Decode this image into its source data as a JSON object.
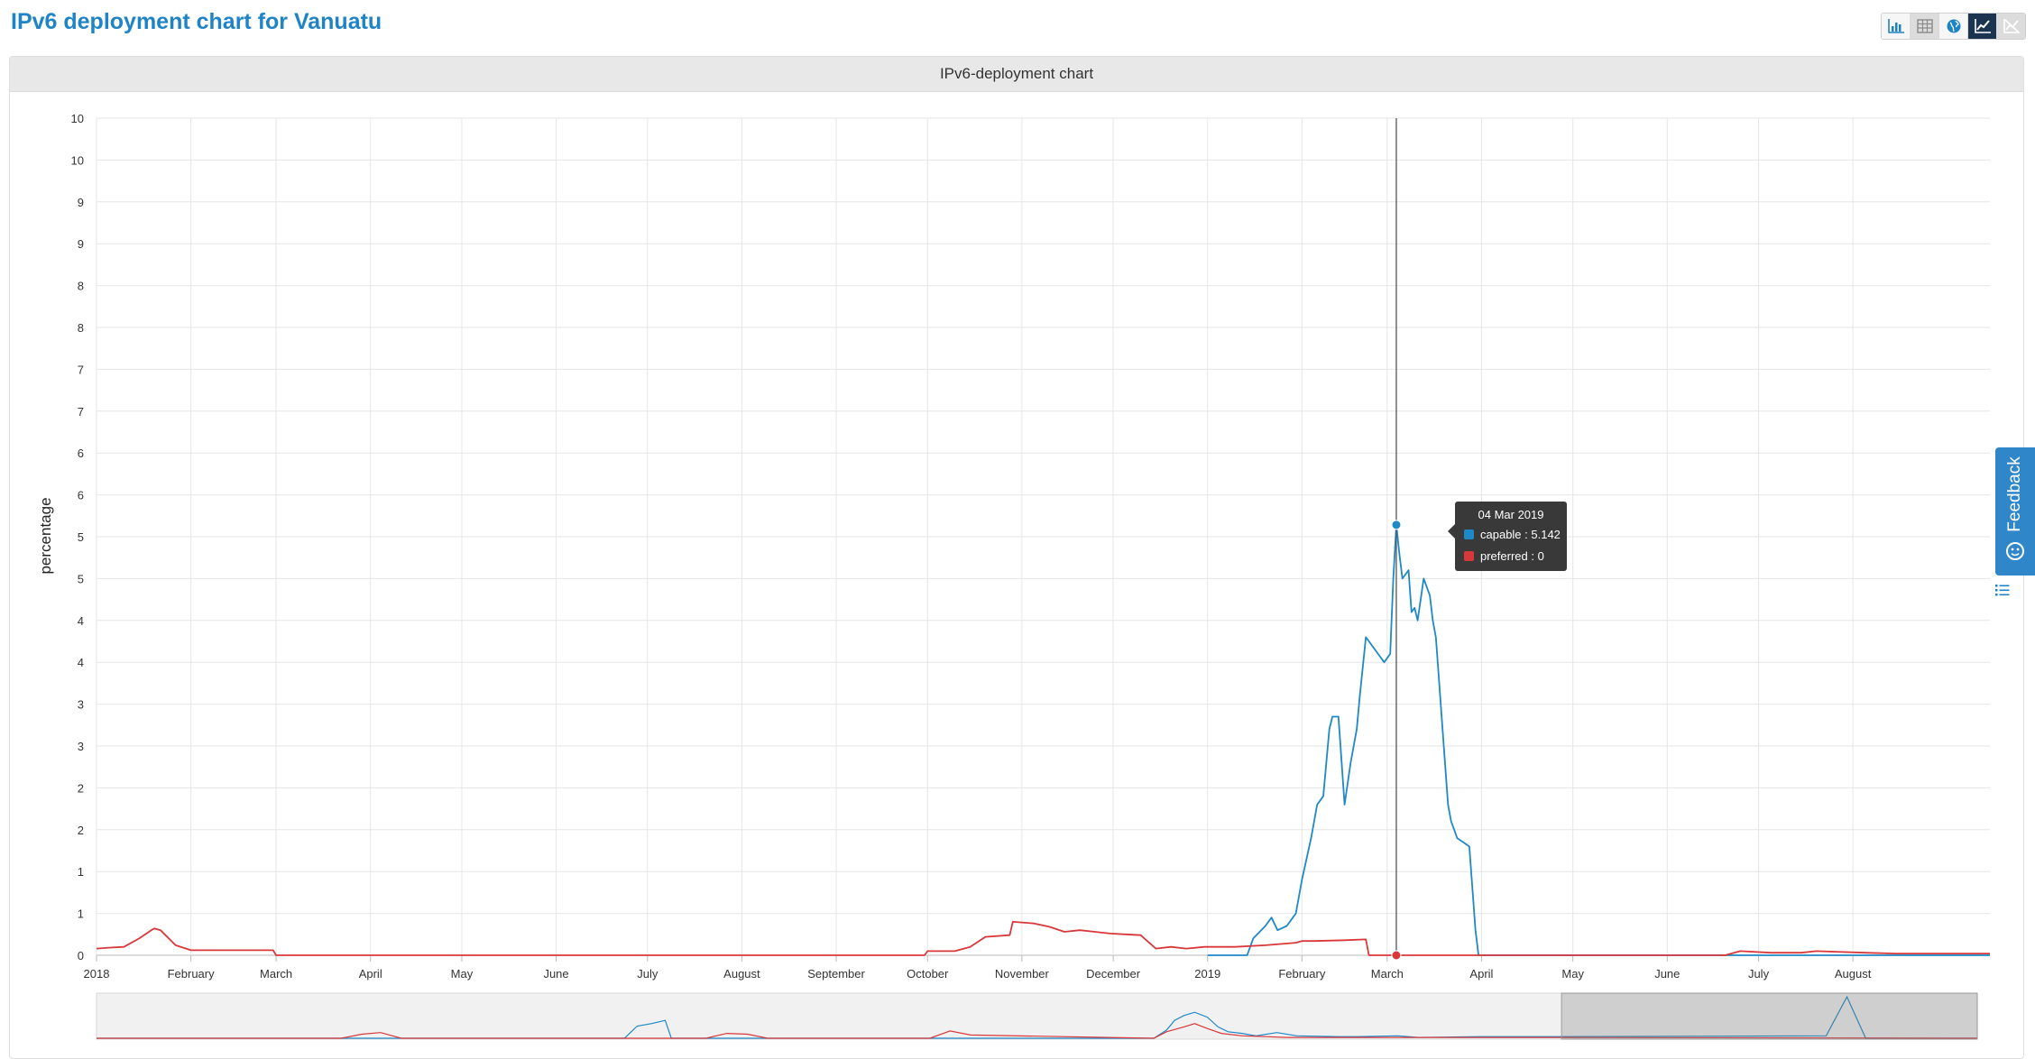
{
  "page": {
    "title": "IPv6 deployment chart for Vanuatu"
  },
  "toolbar": {
    "buttons": [
      {
        "icon": "bar-chart-icon",
        "active": false
      },
      {
        "icon": "table-icon",
        "active": false
      },
      {
        "icon": "globe-icon",
        "active": false
      },
      {
        "icon": "line-chart-icon",
        "active": true
      },
      {
        "icon": "no-line-chart-icon",
        "active": false
      }
    ]
  },
  "panel": {
    "title": "IPv6-deployment chart"
  },
  "feedback": {
    "label": "Feedback"
  },
  "tooltip": {
    "date": "04 Mar 2019",
    "rows": [
      {
        "label": "capable : 5.142",
        "color": "#1f88c7"
      },
      {
        "label": "preferred : 0",
        "color": "#d9383a"
      }
    ]
  },
  "chart_data": {
    "type": "line",
    "title": "IPv6-deployment chart",
    "ylabel": "percentage",
    "xlabel": "",
    "ylim": [
      0,
      10
    ],
    "xlim": [
      "2018-01-01",
      "2019-09-15"
    ],
    "grid": true,
    "y_tick_labels": [
      "0",
      "1",
      "1",
      "2",
      "2",
      "3",
      "3",
      "4",
      "4",
      "5",
      "5",
      "6",
      "6",
      "7",
      "7",
      "8",
      "8",
      "9",
      "9",
      "10",
      "10"
    ],
    "x_ticks": [
      {
        "date": "2018-01-01",
        "label": "2018"
      },
      {
        "date": "2018-02-01",
        "label": "February"
      },
      {
        "date": "2018-03-01",
        "label": "March"
      },
      {
        "date": "2018-04-01",
        "label": "April"
      },
      {
        "date": "2018-05-01",
        "label": "May"
      },
      {
        "date": "2018-06-01",
        "label": "June"
      },
      {
        "date": "2018-07-01",
        "label": "July"
      },
      {
        "date": "2018-08-01",
        "label": "August"
      },
      {
        "date": "2018-09-01",
        "label": "September"
      },
      {
        "date": "2018-10-01",
        "label": "October"
      },
      {
        "date": "2018-11-01",
        "label": "November"
      },
      {
        "date": "2018-12-01",
        "label": "December"
      },
      {
        "date": "2019-01-01",
        "label": "2019"
      },
      {
        "date": "2019-02-01",
        "label": "February"
      },
      {
        "date": "2019-03-01",
        "label": "March"
      },
      {
        "date": "2019-04-01",
        "label": "April"
      },
      {
        "date": "2019-05-01",
        "label": "May"
      },
      {
        "date": "2019-06-01",
        "label": "June"
      },
      {
        "date": "2019-07-01",
        "label": "July"
      },
      {
        "date": "2019-08-01",
        "label": "August"
      }
    ],
    "series": [
      {
        "name": "capable",
        "color": "#1f88c7",
        "x": [
          "2019-01-01",
          "2019-01-14",
          "2019-01-16",
          "2019-01-20",
          "2019-01-22",
          "2019-01-24",
          "2019-01-27",
          "2019-01-30",
          "2019-02-01",
          "2019-02-04",
          "2019-02-06",
          "2019-02-08",
          "2019-02-10",
          "2019-02-11",
          "2019-02-13",
          "2019-02-15",
          "2019-02-17",
          "2019-02-19",
          "2019-02-20",
          "2019-02-22",
          "2019-02-24",
          "2019-02-26",
          "2019-02-28",
          "2019-03-02",
          "2019-03-03",
          "2019-03-04",
          "2019-03-05",
          "2019-03-06",
          "2019-03-08",
          "2019-03-09",
          "2019-03-10",
          "2019-03-11",
          "2019-03-13",
          "2019-03-15",
          "2019-03-16",
          "2019-03-17",
          "2019-03-18",
          "2019-03-20",
          "2019-03-21",
          "2019-03-22",
          "2019-03-23",
          "2019-03-24",
          "2019-03-26",
          "2019-03-28",
          "2019-03-30",
          "2019-03-31",
          "2019-04-01",
          "2019-04-03",
          "2019-09-15"
        ],
        "y": [
          0.0,
          0.0,
          0.2,
          0.35,
          0.45,
          0.3,
          0.35,
          0.5,
          0.9,
          1.4,
          1.8,
          1.9,
          2.7,
          2.85,
          2.85,
          1.8,
          2.3,
          2.7,
          3.1,
          3.8,
          3.7,
          3.6,
          3.5,
          3.6,
          4.5,
          5.142,
          4.8,
          4.5,
          4.6,
          4.1,
          4.15,
          4.0,
          4.5,
          4.3,
          4.0,
          3.8,
          3.3,
          2.3,
          1.8,
          1.6,
          1.5,
          1.4,
          1.35,
          1.3,
          0.3,
          0.0,
          0.0,
          0.0,
          0.0
        ]
      },
      {
        "name": "preferred",
        "color": "#d9383a",
        "x": [
          "2018-01-01",
          "2018-01-05",
          "2018-01-10",
          "2018-01-15",
          "2018-01-19",
          "2018-01-20",
          "2018-01-22",
          "2018-01-27",
          "2018-02-01",
          "2018-02-15",
          "2018-02-28",
          "2018-03-01",
          "2018-09-30",
          "2018-10-01",
          "2018-10-10",
          "2018-10-15",
          "2018-10-20",
          "2018-10-28",
          "2018-10-29",
          "2018-11-05",
          "2018-11-10",
          "2018-11-15",
          "2018-11-20",
          "2018-11-25",
          "2018-11-30",
          "2018-12-05",
          "2018-12-10",
          "2018-12-15",
          "2018-12-20",
          "2018-12-25",
          "2018-12-31",
          "2019-01-10",
          "2019-01-20",
          "2019-01-30",
          "2019-02-01",
          "2019-02-05",
          "2019-02-15",
          "2019-02-22",
          "2019-02-23",
          "2019-03-04",
          "2019-06-20",
          "2019-06-25",
          "2019-07-05",
          "2019-07-15",
          "2019-07-20",
          "2019-08-05",
          "2019-08-15",
          "2019-08-25",
          "2019-09-15"
        ],
        "y": [
          0.08,
          0.09,
          0.1,
          0.2,
          0.3,
          0.32,
          0.3,
          0.12,
          0.06,
          0.06,
          0.06,
          0.0,
          0.0,
          0.05,
          0.05,
          0.1,
          0.22,
          0.24,
          0.4,
          0.38,
          0.34,
          0.28,
          0.3,
          0.28,
          0.26,
          0.25,
          0.24,
          0.08,
          0.1,
          0.08,
          0.1,
          0.1,
          0.12,
          0.15,
          0.17,
          0.17,
          0.18,
          0.19,
          0.0,
          0.0,
          0.0,
          0.05,
          0.03,
          0.03,
          0.05,
          0.03,
          0.02,
          0.02,
          0.02
        ]
      }
    ],
    "hover": {
      "date": "2019-03-04",
      "capable": 5.142,
      "preferred": 0
    }
  },
  "navigator": {
    "xlim": [
      "2012-01-01",
      "2019-09-15"
    ],
    "window": [
      "2018-01-01",
      "2019-09-15"
    ],
    "series": [
      {
        "name": "capable",
        "color": "#1f88c7",
        "x": [
          "2012-01-01",
          "2014-03-01",
          "2014-03-20",
          "2014-04-10",
          "2014-05-01",
          "2014-05-10",
          "2014-06-01",
          "2016-05-01",
          "2016-05-20",
          "2016-06-01",
          "2016-06-15",
          "2016-07-01",
          "2016-07-20",
          "2016-08-05",
          "2016-08-20",
          "2016-09-10",
          "2016-10-01",
          "2016-11-01",
          "2016-12-01",
          "2017-02-01",
          "2017-03-01",
          "2017-05-01",
          "2017-06-01",
          "2017-09-01",
          "2018-01-01",
          "2019-02-01",
          "2019-03-04",
          "2019-04-01",
          "2019-09-15"
        ],
        "y": [
          0.0,
          0.0,
          1.5,
          1.8,
          2.2,
          0.0,
          0.0,
          0.0,
          1.0,
          2.2,
          2.8,
          3.2,
          2.6,
          1.4,
          0.8,
          0.6,
          0.3,
          0.7,
          0.3,
          0.2,
          0.2,
          0.3,
          0.1,
          0.2,
          0.2,
          0.3,
          5.1,
          0.0,
          0.0
        ]
      },
      {
        "name": "preferred",
        "color": "#d9383a",
        "x": [
          "2012-01-01",
          "2013-01-01",
          "2013-02-01",
          "2013-03-01",
          "2013-04-01",
          "2014-07-01",
          "2014-08-01",
          "2014-09-01",
          "2014-10-01",
          "2015-06-01",
          "2015-07-01",
          "2015-08-01",
          "2016-05-01",
          "2016-05-20",
          "2016-06-15",
          "2016-07-01",
          "2016-07-20",
          "2016-08-10",
          "2016-09-10",
          "2016-10-15",
          "2016-11-15",
          "2017-02-01",
          "2017-06-01",
          "2017-09-01",
          "2018-01-01",
          "2019-09-15"
        ],
        "y": [
          0.0,
          0.0,
          0.5,
          0.7,
          0.0,
          0.0,
          0.6,
          0.5,
          0.0,
          0.0,
          0.9,
          0.4,
          0.0,
          0.8,
          1.4,
          1.8,
          1.2,
          0.6,
          0.3,
          0.2,
          0.1,
          0.1,
          0.1,
          0.1,
          0.1,
          0.0
        ]
      }
    ]
  }
}
